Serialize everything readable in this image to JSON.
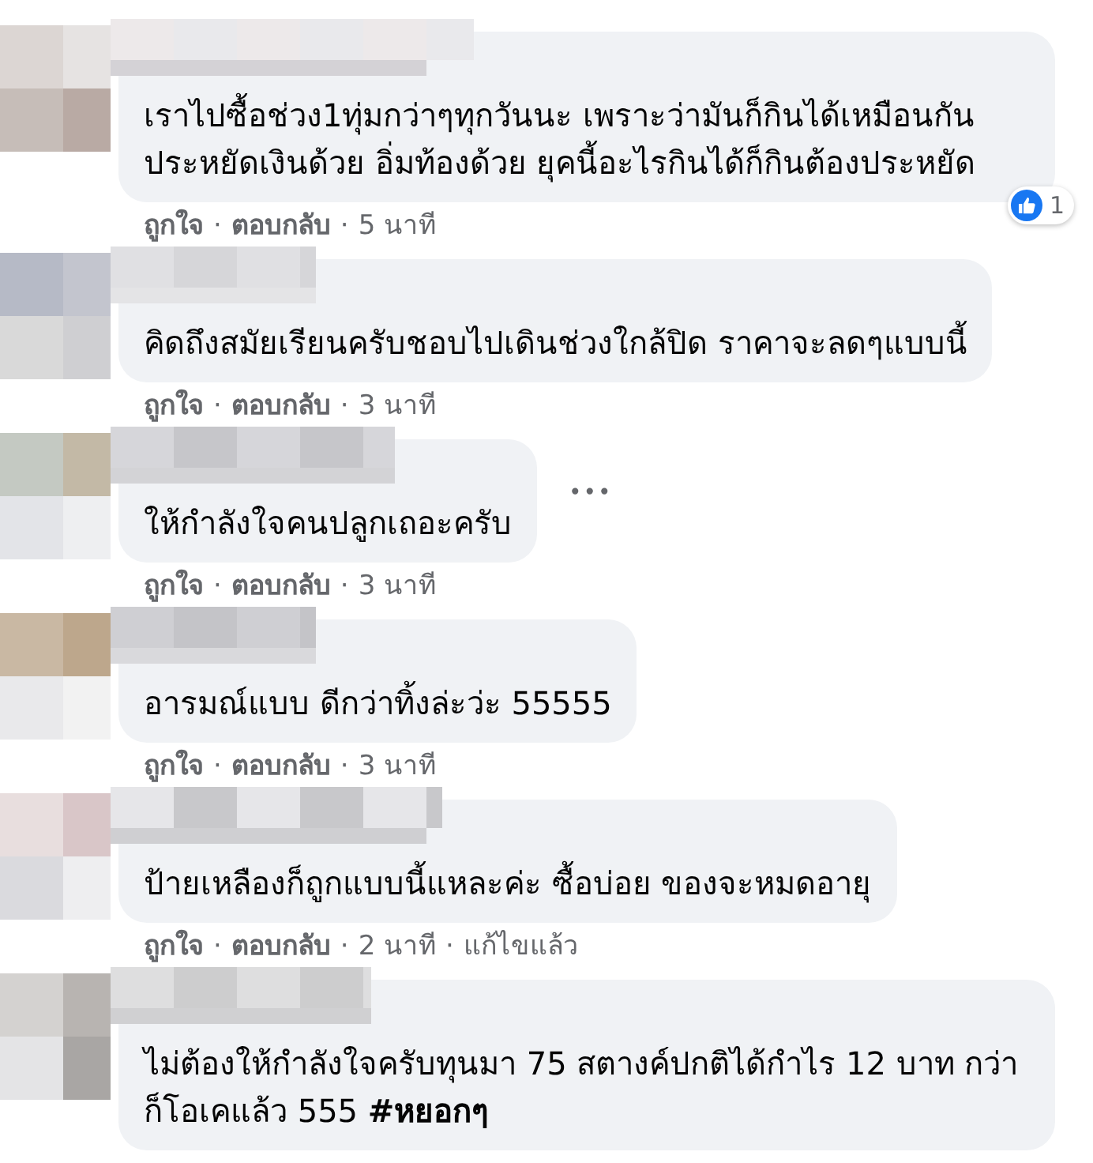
{
  "comments": [
    {
      "text": "เราไปซื้อช่วง1ทุ่มกว่าๆทุกวันนะ เพราะว่ามันก็กินได้เหมือนกัน ประหยัดเงินด้วย อิ่มท้องด้วย ยุคนี้อะไรกินได้ก็กินต้องประหยัด",
      "reaction_count": "1",
      "actions": [
        {
          "kind": "link",
          "label": "ถูกใจ"
        },
        {
          "kind": "separator",
          "label": "·"
        },
        {
          "kind": "link",
          "label": "ตอบกลับ"
        },
        {
          "kind": "separator",
          "label": "·"
        },
        {
          "kind": "time",
          "label": "5 นาที"
        }
      ]
    },
    {
      "text": "คิดถึงสมัยเรียนครับชอบไปเดินช่วงใกล้ปิด ราคาจะลดๆแบบนี้",
      "actions": [
        {
          "kind": "link",
          "label": "ถูกใจ"
        },
        {
          "kind": "separator",
          "label": "·"
        },
        {
          "kind": "link",
          "label": "ตอบกลับ"
        },
        {
          "kind": "separator",
          "label": "·"
        },
        {
          "kind": "time",
          "label": "3 นาที"
        }
      ]
    },
    {
      "text": "ให้กำลังใจคนปลูกเถอะครับ",
      "more": "•••",
      "actions": [
        {
          "kind": "link",
          "label": "ถูกใจ"
        },
        {
          "kind": "separator",
          "label": "·"
        },
        {
          "kind": "link",
          "label": "ตอบกลับ"
        },
        {
          "kind": "separator",
          "label": "·"
        },
        {
          "kind": "time",
          "label": "3 นาที"
        }
      ]
    },
    {
      "text": "อารมณ์แบบ ดีกว่าทิ้งล่ะว่ะ 55555",
      "actions": [
        {
          "kind": "link",
          "label": "ถูกใจ"
        },
        {
          "kind": "separator",
          "label": "·"
        },
        {
          "kind": "link",
          "label": "ตอบกลับ"
        },
        {
          "kind": "separator",
          "label": "·"
        },
        {
          "kind": "time",
          "label": "3 นาที"
        }
      ]
    },
    {
      "text": "ป้ายเหลืองก็ถูกแบบนี้แหละค่ะ ซื้อบ่อย ของจะหมดอายุ",
      "actions": [
        {
          "kind": "link",
          "label": "ถูกใจ"
        },
        {
          "kind": "separator",
          "label": "·"
        },
        {
          "kind": "link",
          "label": "ตอบกลับ"
        },
        {
          "kind": "separator",
          "label": "·"
        },
        {
          "kind": "time",
          "label": "2 นาที"
        },
        {
          "kind": "separator",
          "label": "·"
        },
        {
          "kind": "time",
          "label": "แก้ไขแล้ว"
        }
      ]
    },
    {
      "text": "ไม่ต้องให้กำลังใจครับทุนมา 75 สตางค์ปกติได้กำไร 12 บาท กว่าก็โอเคแล้ว 555 **#หยอกๆ**"
    }
  ]
}
